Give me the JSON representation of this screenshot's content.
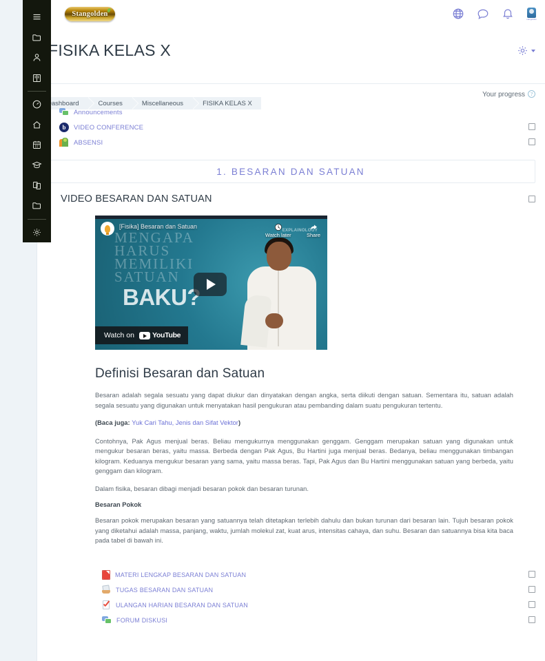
{
  "topbar": {
    "logo_text": "Stangolden",
    "icons": [
      {
        "name": "language-globe-icon",
        "label": "Language"
      },
      {
        "name": "messages-icon",
        "label": "Messages"
      },
      {
        "name": "notifications-bell-icon",
        "label": "Notifications"
      }
    ],
    "avatar_caption": "stangolden"
  },
  "sidebar": {
    "items": [
      {
        "name": "menu-toggle",
        "icon": "hamburger-icon"
      },
      {
        "name": "files-folder",
        "icon": "folder-icon"
      },
      {
        "name": "profile",
        "icon": "user-icon"
      },
      {
        "name": "courses-book",
        "icon": "book-icon"
      },
      {
        "name": "dashboard-gauge",
        "icon": "speedometer-icon"
      },
      {
        "name": "site-home",
        "icon": "home-icon"
      },
      {
        "name": "calendar",
        "icon": "calendar-icon"
      },
      {
        "name": "grades",
        "icon": "graduation-cap-icon"
      },
      {
        "name": "private-files",
        "icon": "copy-files-icon"
      },
      {
        "name": "content-bank",
        "icon": "folder-icon"
      },
      {
        "name": "site-administration",
        "icon": "gear-icon"
      }
    ]
  },
  "course": {
    "title": "FISIKA KELAS X",
    "breadcrumbs": [
      "Dashboard",
      "Courses",
      "Miscellaneous",
      "FISIKA KELAS X"
    ],
    "settings_label": "Settings"
  },
  "progress": {
    "label": "Your progress",
    "help_glyph": "?"
  },
  "general_activities": [
    {
      "label": "Announcements",
      "icon": "forum-icon",
      "has_checkbox": false
    },
    {
      "label": "VIDEO CONFERENCE",
      "icon": "bigbluebutton-icon",
      "has_checkbox": true
    },
    {
      "label": "ABSENSI",
      "icon": "attendance-icon",
      "has_checkbox": true
    }
  ],
  "section": {
    "title": "1. BESARAN DAN SATUAN",
    "subsection_title": "VIDEO BESARAN DAN SATUAN"
  },
  "video": {
    "title": "[Fisika] Besaran dan Satuan",
    "overlay_lines": [
      "MENGAPA",
      "HARUS",
      "MEMILIKI",
      "SATUAN"
    ],
    "overlay_emphasis": "BAKU?",
    "watch_later": "Watch later",
    "share": "Share",
    "watch_on": "Watch on",
    "youtube_word": "YouTube",
    "brand_small": "EXPLAINOLOGY"
  },
  "article": {
    "heading": "Definisi Besaran dan Satuan",
    "paragraph1": "Besaran adalah segala sesuatu yang dapat diukur dan dinyatakan dengan angka, serta diikuti dengan satuan. Sementara itu, satuan adalah segala sesuatu yang digunakan untuk menyatakan hasil pengukuran atau pembanding dalam suatu pengukuran tertentu.",
    "baca_juga_prefix": "(Baca juga: ",
    "baca_juga_link": "Yuk Cari Tahu, Jenis dan Sifat Vektor",
    "baca_juga_suffix": ")",
    "paragraph2": "Contohnya, Pak Agus menjual beras. Beliau mengukurnya menggunakan genggam. Genggam merupakan satuan yang digunakan untuk mengukur besaran beras, yaitu massa. Berbeda dengan Pak Agus, Bu Hartini juga menjual beras. Bedanya, beliau menggunakan timbangan kilogram. Keduanya mengukur besaran yang sama, yaitu massa beras. Tapi, Pak Agus dan Bu Hartini menggunakan satuan yang berbeda, yaitu genggam dan kilogram.",
    "paragraph3": "Dalam fisika, besaran dibagi menjadi besaran pokok dan besaran turunan.",
    "subheading": "Besaran Pokok",
    "paragraph4": "Besaran pokok merupakan besaran yang satuannya telah ditetapkan terlebih dahulu dan bukan turunan dari besaran lain. Tujuh besaran pokok yang diketahui adalah massa, panjang, waktu, jumlah molekul zat, kuat arus, intensitas cahaya, dan suhu. Besaran dan satuannya bisa kita baca pada tabel di bawah ini."
  },
  "section_activities": [
    {
      "label": "MATERI LENGKAP BESARAN DAN SATUAN",
      "icon": "pdf-file-icon",
      "has_checkbox": true
    },
    {
      "label": "TUGAS BESARAN DAN SATUAN",
      "icon": "assignment-icon",
      "has_checkbox": true
    },
    {
      "label": "ULANGAN HARIAN BESARAN DAN SATUAN",
      "icon": "quiz-icon",
      "has_checkbox": true
    },
    {
      "label": "FORUM DISKUSI",
      "icon": "forum-icon",
      "has_checkbox": true
    }
  ],
  "colors": {
    "accent": "#7b7fd4",
    "sidebar_bg": "#13170d",
    "text_dark": "#2e3a45",
    "body_text": "#5d6770",
    "rail_bg": "#eef3f7"
  }
}
